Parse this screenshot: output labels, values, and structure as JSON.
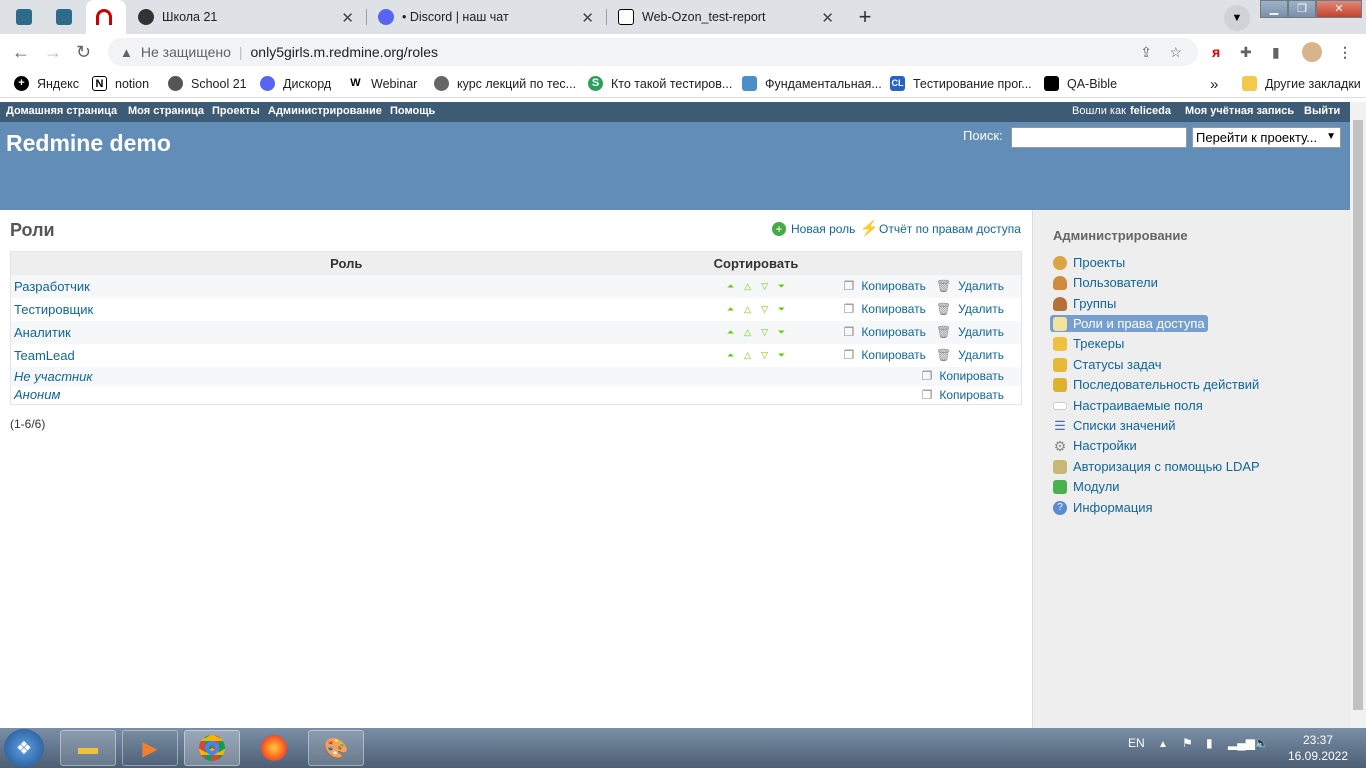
{
  "browser": {
    "tabs": [
      {
        "title": "",
        "icon": "redmine-square-icon"
      },
      {
        "title": "",
        "icon": "redmine-square-icon"
      },
      {
        "title": "",
        "icon": "redmine-arc-icon"
      },
      {
        "title": "Школа 21",
        "icon": "school-icon"
      },
      {
        "title": "• Discord | наш чат",
        "icon": "discord-icon"
      },
      {
        "title": "Web-Ozon_test-report",
        "icon": "notion-icon"
      }
    ],
    "address": {
      "insecure_label": "Не защищено",
      "url": "only5girls.m.redmine.org/roles"
    },
    "bookmarks": [
      {
        "label": "Яндекс"
      },
      {
        "label": "notion"
      },
      {
        "label": "School 21"
      },
      {
        "label": "Дискорд"
      },
      {
        "label": "Webinar"
      },
      {
        "label": "курс лекций по тес..."
      },
      {
        "label": "Кто такой тестиров..."
      },
      {
        "label": "Фундаментальная..."
      },
      {
        "label": "Тестирование прог..."
      },
      {
        "label": "QA-Bible"
      }
    ],
    "bookmarks_more": "»",
    "other_bookmarks": "Другие закладки"
  },
  "top_menu": {
    "items": [
      "Домашняя страница",
      "Моя страница",
      "Проекты",
      "Администрирование",
      "Помощь"
    ],
    "logged_as_prefix": "Вошли как",
    "user": "feliceda",
    "my_account": "Моя учётная запись",
    "logout": "Выйти"
  },
  "header": {
    "title": "Redmine demo",
    "search_label": "Поиск:",
    "jump_placeholder": "Перейти к проекту..."
  },
  "main": {
    "title": "Роли",
    "new_role": "Новая роль",
    "permissions_report": "Отчёт по правам доступа",
    "columns": {
      "role": "Роль",
      "sort": "Сортировать"
    },
    "roles": [
      {
        "name": "Разработчик",
        "copy": "Копировать",
        "delete": "Удалить"
      },
      {
        "name": "Тестировщик",
        "copy": "Копировать",
        "delete": "Удалить"
      },
      {
        "name": "Аналитик",
        "copy": "Копировать",
        "delete": "Удалить"
      },
      {
        "name": "TeamLead",
        "copy": "Копировать",
        "delete": "Удалить"
      }
    ],
    "builtin_roles": [
      {
        "name": "Не участник",
        "copy": "Копировать"
      },
      {
        "name": "Аноним",
        "copy": "Копировать"
      }
    ],
    "pagination": "(1-6/6)"
  },
  "sidebar": {
    "title": "Администрирование",
    "items": [
      {
        "label": "Проекты",
        "icon": "projects-icon"
      },
      {
        "label": "Пользователи",
        "icon": "user-icon"
      },
      {
        "label": "Группы",
        "icon": "group-icon"
      },
      {
        "label": "Роли и права доступа",
        "icon": "role-icon"
      },
      {
        "label": "Трекеры",
        "icon": "tracker-icon"
      },
      {
        "label": "Статусы задач",
        "icon": "status-icon"
      },
      {
        "label": "Последовательность действий",
        "icon": "workflow-icon"
      },
      {
        "label": "Настраиваемые поля",
        "icon": "custom-fields-icon"
      },
      {
        "label": "Списки значений",
        "icon": "list-icon"
      },
      {
        "label": "Настройки",
        "icon": "settings-icon"
      },
      {
        "label": "Авторизация с помощью LDAP",
        "icon": "ldap-icon"
      },
      {
        "label": "Модули",
        "icon": "plugin-icon"
      },
      {
        "label": "Информация",
        "icon": "info-icon"
      }
    ]
  },
  "taskbar": {
    "lang": "EN",
    "time": "23:37",
    "date": "16.09.2022"
  }
}
